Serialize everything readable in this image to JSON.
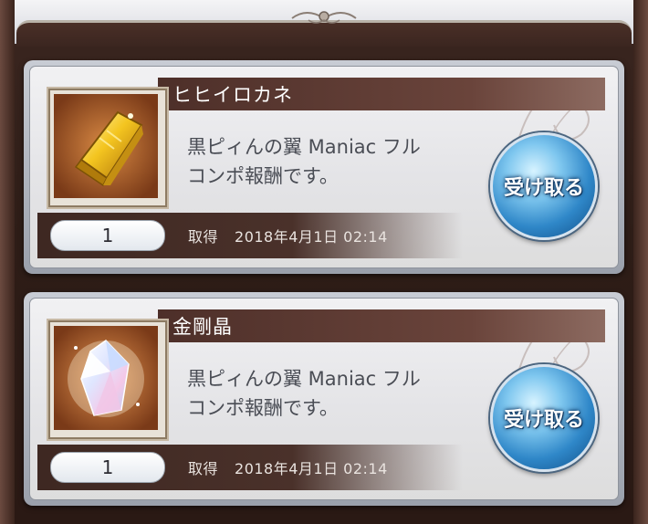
{
  "rewards": [
    {
      "name": "ヒヒイロカネ",
      "description_line1": "黒ピィんの翼 Maniac フル",
      "description_line2": "コンポ報酬です。",
      "quantity": "1",
      "acquired_label": "取得",
      "acquired_date": "2018年4月1日 02:14",
      "button_label": "受け取る",
      "icon": "gold-ingot-icon"
    },
    {
      "name": "金剛晶",
      "description_line1": "黒ピィんの翼 Maniac フル",
      "description_line2": "コンポ報酬です。",
      "quantity": "1",
      "acquired_label": "取得",
      "acquired_date": "2018年4月1日 02:14",
      "button_label": "受け取る",
      "icon": "crystal-icon"
    }
  ],
  "colors": {
    "title_bar": "#4d2f29",
    "background": "#2e1d17",
    "button_blue": "#2f87c8"
  }
}
